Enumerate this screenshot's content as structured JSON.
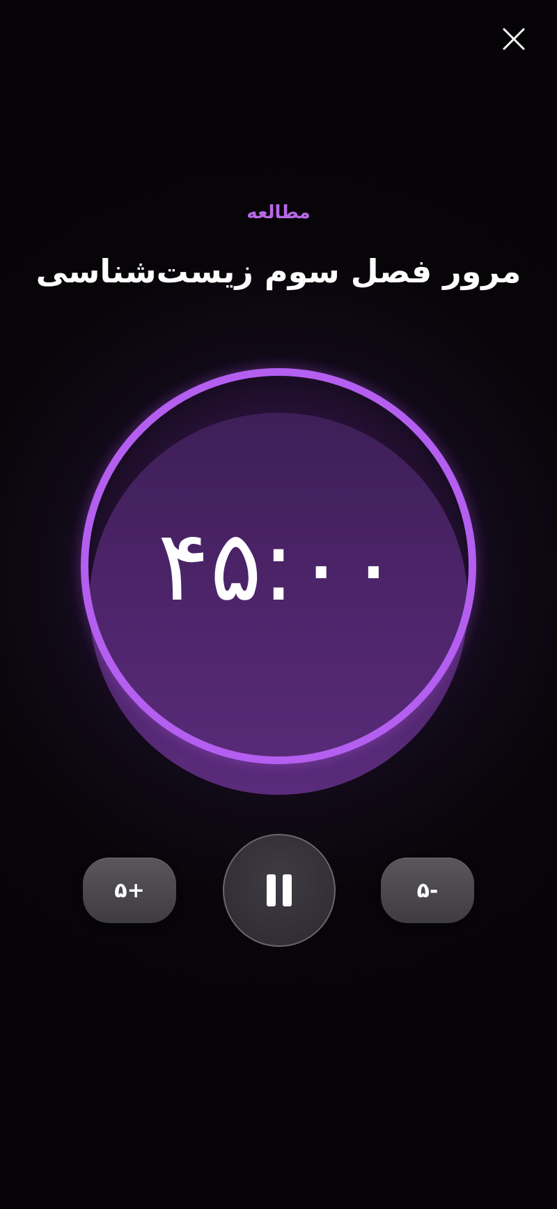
{
  "header": {
    "close_icon": "close-icon"
  },
  "session": {
    "category": "مطالعه",
    "title": "مرور فصل سوم زیست‌شناسی"
  },
  "timer": {
    "display": "۴۵:۰۰",
    "ring_color": "#b45ff0",
    "disc_color": "#4c2469"
  },
  "controls": {
    "add_label": "۵+",
    "subtract_label": "۵-",
    "pause_icon": "pause-icon"
  },
  "colors": {
    "accent": "#b768e6",
    "background": "#060407",
    "button": "#4a474d"
  }
}
